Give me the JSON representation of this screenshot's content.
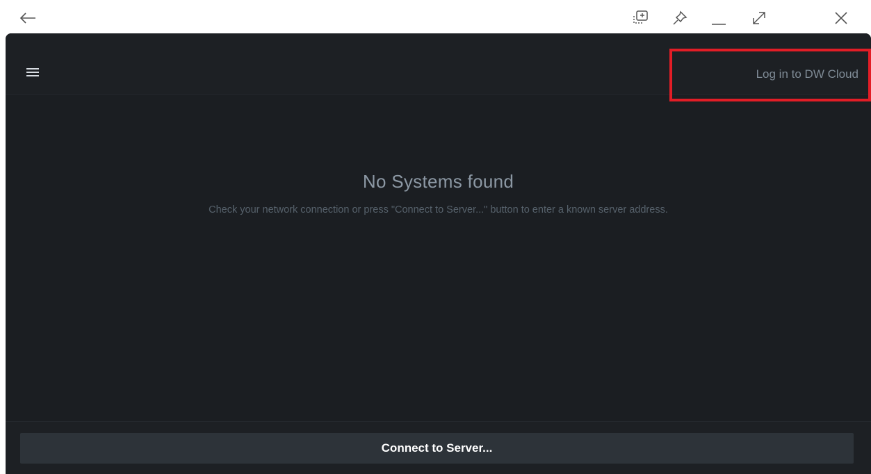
{
  "window": {
    "icons": [
      "back-arrow-icon",
      "screen-capture-icon",
      "pin-icon",
      "minimize-icon",
      "expand-icon",
      "close-icon"
    ]
  },
  "header": {
    "login_label": "Log in to DW Cloud"
  },
  "main": {
    "title": "No Systems found",
    "subtitle": "Check your network connection or press \"Connect to Server...\" button to enter a known server address."
  },
  "footer": {
    "connect_label": "Connect to Server..."
  },
  "colors": {
    "background": "#1b1e22",
    "highlight": "#e21d26",
    "button": "#2d3339"
  }
}
